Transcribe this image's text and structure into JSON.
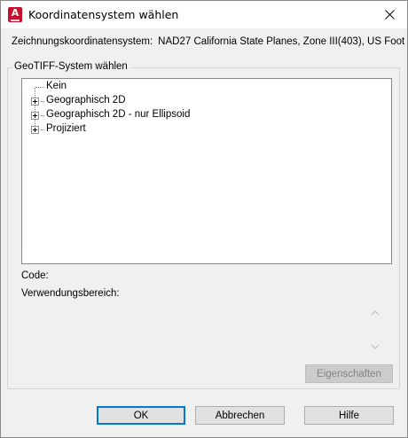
{
  "window": {
    "title": "Koordinatensystem wählen",
    "app_icon": "autocad-icon",
    "app_icon_letter": "A",
    "close_icon": "close-icon"
  },
  "drawing_cs": {
    "label": "Zeichnungskoordinatensystem:",
    "value": "NAD27 California State Planes, Zone III(403), US Foot"
  },
  "geotiff": {
    "group_label": "GeoTIFF-System wählen",
    "tree": [
      {
        "label": "Kein",
        "expandable": false
      },
      {
        "label": "Geographisch 2D",
        "expandable": true
      },
      {
        "label": "Geographisch 2D - nur Ellipsoid",
        "expandable": true
      },
      {
        "label": "Projiziert",
        "expandable": true
      }
    ],
    "code_label": "Code:",
    "usage_label": "Verwendungsbereich:",
    "properties_button": "Eigenschaften"
  },
  "buttons": {
    "ok": "OK",
    "cancel": "Abbrechen",
    "help": "Hilfe"
  }
}
